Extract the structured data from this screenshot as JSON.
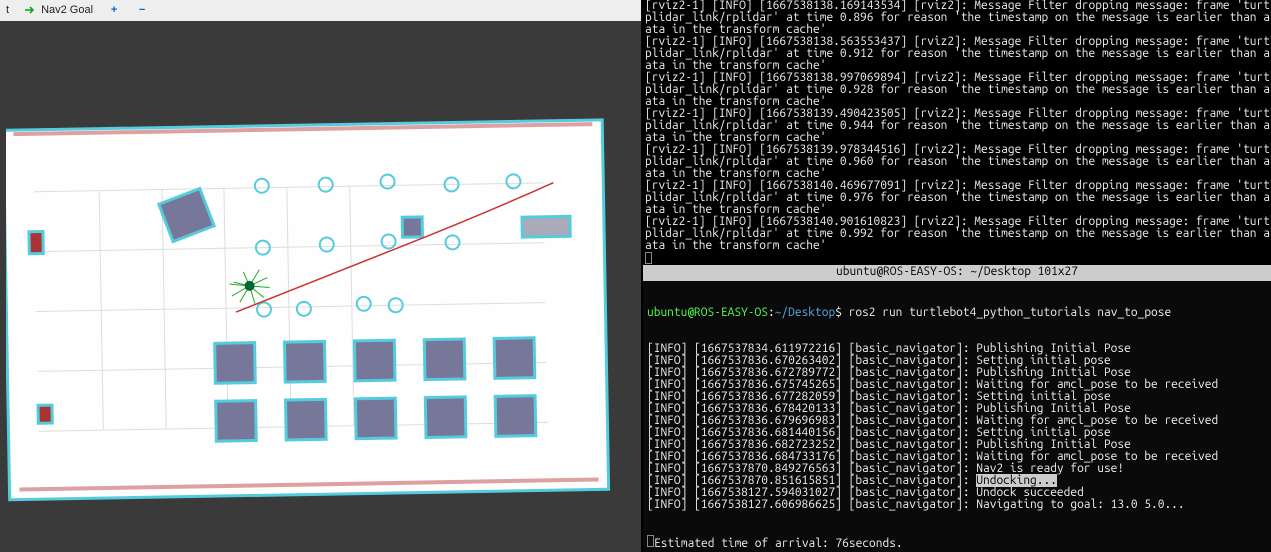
{
  "toolbar": {
    "tool_t": "t",
    "nav_goal": "Nav2 Goal",
    "plus": "+",
    "minus": "−"
  },
  "top_log": [
    "[rviz2-1] [INFO] [1667538138.169143534] [rviz2]: Message Filter dropping message: frame 'turtleb",
    "plidar_link/rplidar' at time 0.896 for reason 'the timestamp on the message is earlier than all ",
    "ata in the transform cache'",
    "[rviz2-1] [INFO] [1667538138.563553437] [rviz2]: Message Filter dropping message: frame 'turtleb",
    "plidar_link/rplidar' at time 0.912 for reason 'the timestamp on the message is earlier than all ",
    "ata in the transform cache'",
    "[rviz2-1] [INFO] [1667538138.997069894] [rviz2]: Message Filter dropping message: frame 'turtleb",
    "plidar_link/rplidar' at time 0.928 for reason 'the timestamp on the message is earlier than all ",
    "ata in the transform cache'",
    "[rviz2-1] [INFO] [1667538139.490423505] [rviz2]: Message Filter dropping message: frame 'turtleb",
    "plidar_link/rplidar' at time 0.944 for reason 'the timestamp on the message is earlier than all ",
    "ata in the transform cache'",
    "[rviz2-1] [INFO] [1667538139.978344516] [rviz2]: Message Filter dropping message: frame 'turtleb",
    "plidar_link/rplidar' at time 0.960 for reason 'the timestamp on the message is earlier than all ",
    "ata in the transform cache'",
    "[rviz2-1] [INFO] [1667538140.469677091] [rviz2]: Message Filter dropping message: frame 'turtleb",
    "plidar_link/rplidar' at time 0.976 for reason 'the timestamp on the message is earlier than all ",
    "ata in the transform cache'",
    "[rviz2-1] [INFO] [1667538140.901610823] [rviz2]: Message Filter dropping message: frame 'turtleb",
    "plidar_link/rplidar' at time 0.992 for reason 'the timestamp on the message is earlier than all ",
    "ata in the transform cache'"
  ],
  "term_title": "ubuntu@ROS-EASY-OS: ~/Desktop 101x27",
  "prompt": {
    "user_host": "ubuntu@ROS-EASY-OS",
    "sep": ":",
    "path": "~/Desktop",
    "dollar": "$",
    "cmd": " ros2 run turtlebot4_python_tutorials nav_to_pose"
  },
  "bottom_lines": [
    "[INFO] [1667537834.611972216] [basic_navigator]: Publishing Initial Pose",
    "[INFO] [1667537836.670263402] [basic_navigator]: Setting initial pose",
    "[INFO] [1667537836.672789772] [basic_navigator]: Publishing Initial Pose",
    "[INFO] [1667537836.675745265] [basic_navigator]: Waiting for amcl_pose to be received",
    "[INFO] [1667537836.677282059] [basic_navigator]: Setting initial pose",
    "[INFO] [1667537836.678420133] [basic_navigator]: Publishing Initial Pose",
    "[INFO] [1667537836.679696983] [basic_navigator]: Waiting for amcl_pose to be received",
    "[INFO] [1667537836.681440156] [basic_navigator]: Setting initial pose",
    "[INFO] [1667537836.682723252] [basic_navigator]: Publishing Initial Pose",
    "[INFO] [1667537836.684733176] [basic_navigator]: Waiting for amcl_pose to be received",
    "[INFO] [1667537870.849276563] [basic_navigator]: Nav2 is ready for use!",
    "[INFO] [1667537870.851615851] [basic_navigator]: ",
    "[INFO] [1667538127.594031027] [basic_navigator]: Undock succeeded",
    "[INFO] [1667538127.606986625] [basic_navigator]: Navigating to goal: 13.0 5.0..."
  ],
  "undocking": "Undocking...",
  "eta": "Estimated time of arrival: 76seconds."
}
